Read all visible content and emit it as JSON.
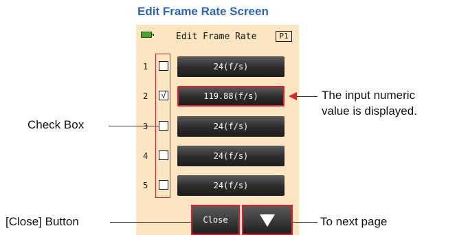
{
  "heading": "Edit Frame Rate Screen",
  "screen": {
    "title": "Edit Frame Rate",
    "page_badge": "P1",
    "rows": [
      {
        "number": "1",
        "checked": false,
        "value": "24(f/s)"
      },
      {
        "number": "2",
        "checked": true,
        "check_mark": "√",
        "value": "119.88(f/s)"
      },
      {
        "number": "3",
        "checked": false,
        "value": "24(f/s)"
      },
      {
        "number": "4",
        "checked": false,
        "value": "24(f/s)"
      },
      {
        "number": "5",
        "checked": false,
        "value": "24(f/s)"
      }
    ],
    "close_label": "Close"
  },
  "callouts": {
    "check_box": "Check Box",
    "input_numeric_line1": "The input numeric",
    "input_numeric_line2": "value is displayed.",
    "close_button": "[Close] Button",
    "next_page": "To next page"
  },
  "colors": {
    "highlight": "#e0202c",
    "screen_bg": "#fbe6c1",
    "heading": "#2b63b8"
  }
}
